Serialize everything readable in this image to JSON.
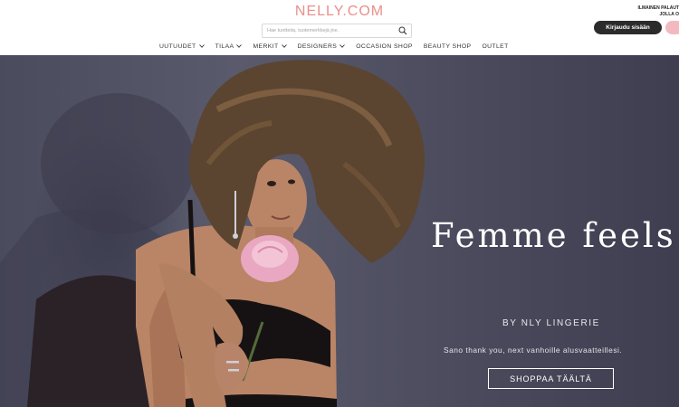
{
  "header": {
    "logo": "NELLY.COM",
    "search": {
      "placeholder": "Hae tuotteita, tuotemerkkejä jne."
    },
    "promo": {
      "line1": "ILMAINEN PALAUT",
      "line2": "JOLLA O"
    },
    "login_label": "Kirjaudu sisään"
  },
  "nav": {
    "items": [
      {
        "label": "UUTUUDET",
        "has_dropdown": true
      },
      {
        "label": "TILAA",
        "has_dropdown": true
      },
      {
        "label": "MERKIT",
        "has_dropdown": true
      },
      {
        "label": "DESIGNERS",
        "has_dropdown": true
      },
      {
        "label": "OCCASION SHOP",
        "has_dropdown": false
      },
      {
        "label": "BEAUTY SHOP",
        "has_dropdown": false
      },
      {
        "label": "OUTLET",
        "has_dropdown": false
      }
    ]
  },
  "hero": {
    "title": "Femme feels",
    "subtitle": "BY NLY LINGERIE",
    "tagline": "Sano thank you, next vanhoille alusvaatteillesi.",
    "cta_label": "SHOPPAA TÄÄLTÄ"
  },
  "colors": {
    "brand": "#e8908a",
    "login_button": "#2b2b2b",
    "bag_button": "#f3b9c0",
    "hero_background": "#4f4f62"
  }
}
